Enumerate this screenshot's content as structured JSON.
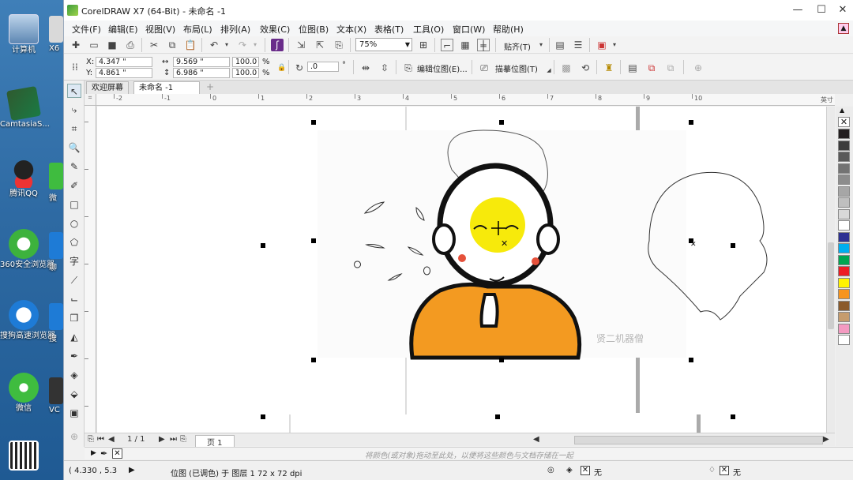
{
  "desktop": {
    "icons": [
      {
        "label": "计算机",
        "icon": "computer-icon"
      },
      {
        "label": "CamtasiaS...",
        "icon": "camtasia-icon"
      },
      {
        "label": "腾讯QQ",
        "icon": "qq-icon"
      },
      {
        "label": "360安全浏览器",
        "icon": "browser-360-icon"
      },
      {
        "label": "搜狗高速浏览器",
        "icon": "sogou-browser-icon"
      },
      {
        "label": "微信",
        "icon": "wechat-icon"
      }
    ],
    "partial_icons": [
      {
        "label": "X6",
        "icon": "partial-app-icon"
      },
      {
        "label": "微",
        "icon": "partial-app-icon"
      },
      {
        "label": "聊",
        "icon": "partial-app-icon"
      },
      {
        "label": "搜",
        "icon": "partial-app-icon"
      },
      {
        "label": "VC",
        "icon": "partial-app-icon"
      }
    ]
  },
  "window": {
    "title": "CorelDRAW X7 (64-Bit) - 未命名 -1",
    "minimize": "—",
    "maximize": "☐",
    "close": "✕"
  },
  "menu": [
    "文件(F)",
    "编辑(E)",
    "视图(V)",
    "布局(L)",
    "排列(A)",
    "效果(C)",
    "位图(B)",
    "文本(X)",
    "表格(T)",
    "工具(O)",
    "窗口(W)",
    "帮助(H)"
  ],
  "toolbar": {
    "zoom": "75%",
    "snap": "贴齐(T)"
  },
  "property_bar": {
    "x_label": "X:",
    "x_value": "4.347 \"",
    "y_label": "Y:",
    "y_value": "4.861 \"",
    "w_value": "9.569 \"",
    "h_value": "6.986 \"",
    "w_percent": "100.0",
    "h_percent": "100.0",
    "percent_sign": "%",
    "rotation": ".0",
    "degree": "°",
    "edit_bitmap": "编辑位图(E)...",
    "trace_bitmap": "描摹位图(T)"
  },
  "tabs": [
    {
      "label": "欢迎屏幕",
      "active": false
    },
    {
      "label": "未命名 -1",
      "active": true
    }
  ],
  "ruler": {
    "unit": "英寸",
    "labels": [
      "-2",
      "-1",
      "0",
      "1",
      "2",
      "3",
      "4",
      "5",
      "6",
      "7",
      "8",
      "9",
      "10"
    ]
  },
  "canvas": {
    "watermark": "贤二机器僧"
  },
  "palette": [
    "#231f20",
    "#3c3c3c",
    "#595959",
    "#737373",
    "#8c8c8c",
    "#a6a6a6",
    "#bfbfbf",
    "#d9d9d9",
    "#ffffff",
    "#2e3192",
    "#00aeef",
    "#00a651",
    "#ed1c24",
    "#fff200",
    "#f7941d",
    "#8b5a2b",
    "#c69c6d",
    "#f49ac1",
    "#ffffff"
  ],
  "page_nav": {
    "page_count": "1 / 1",
    "page_tab": "页 1"
  },
  "doc_palette_hint": "将颜色(或对象)拖动至此处，以便将这些颜色与文档存储在一起",
  "status": {
    "coords": "( 4.330 , 5.3",
    "info": "位图 (已调色) 于 图层 1 72 x 72 dpi",
    "fill_label": "无",
    "outline_label": "无"
  }
}
